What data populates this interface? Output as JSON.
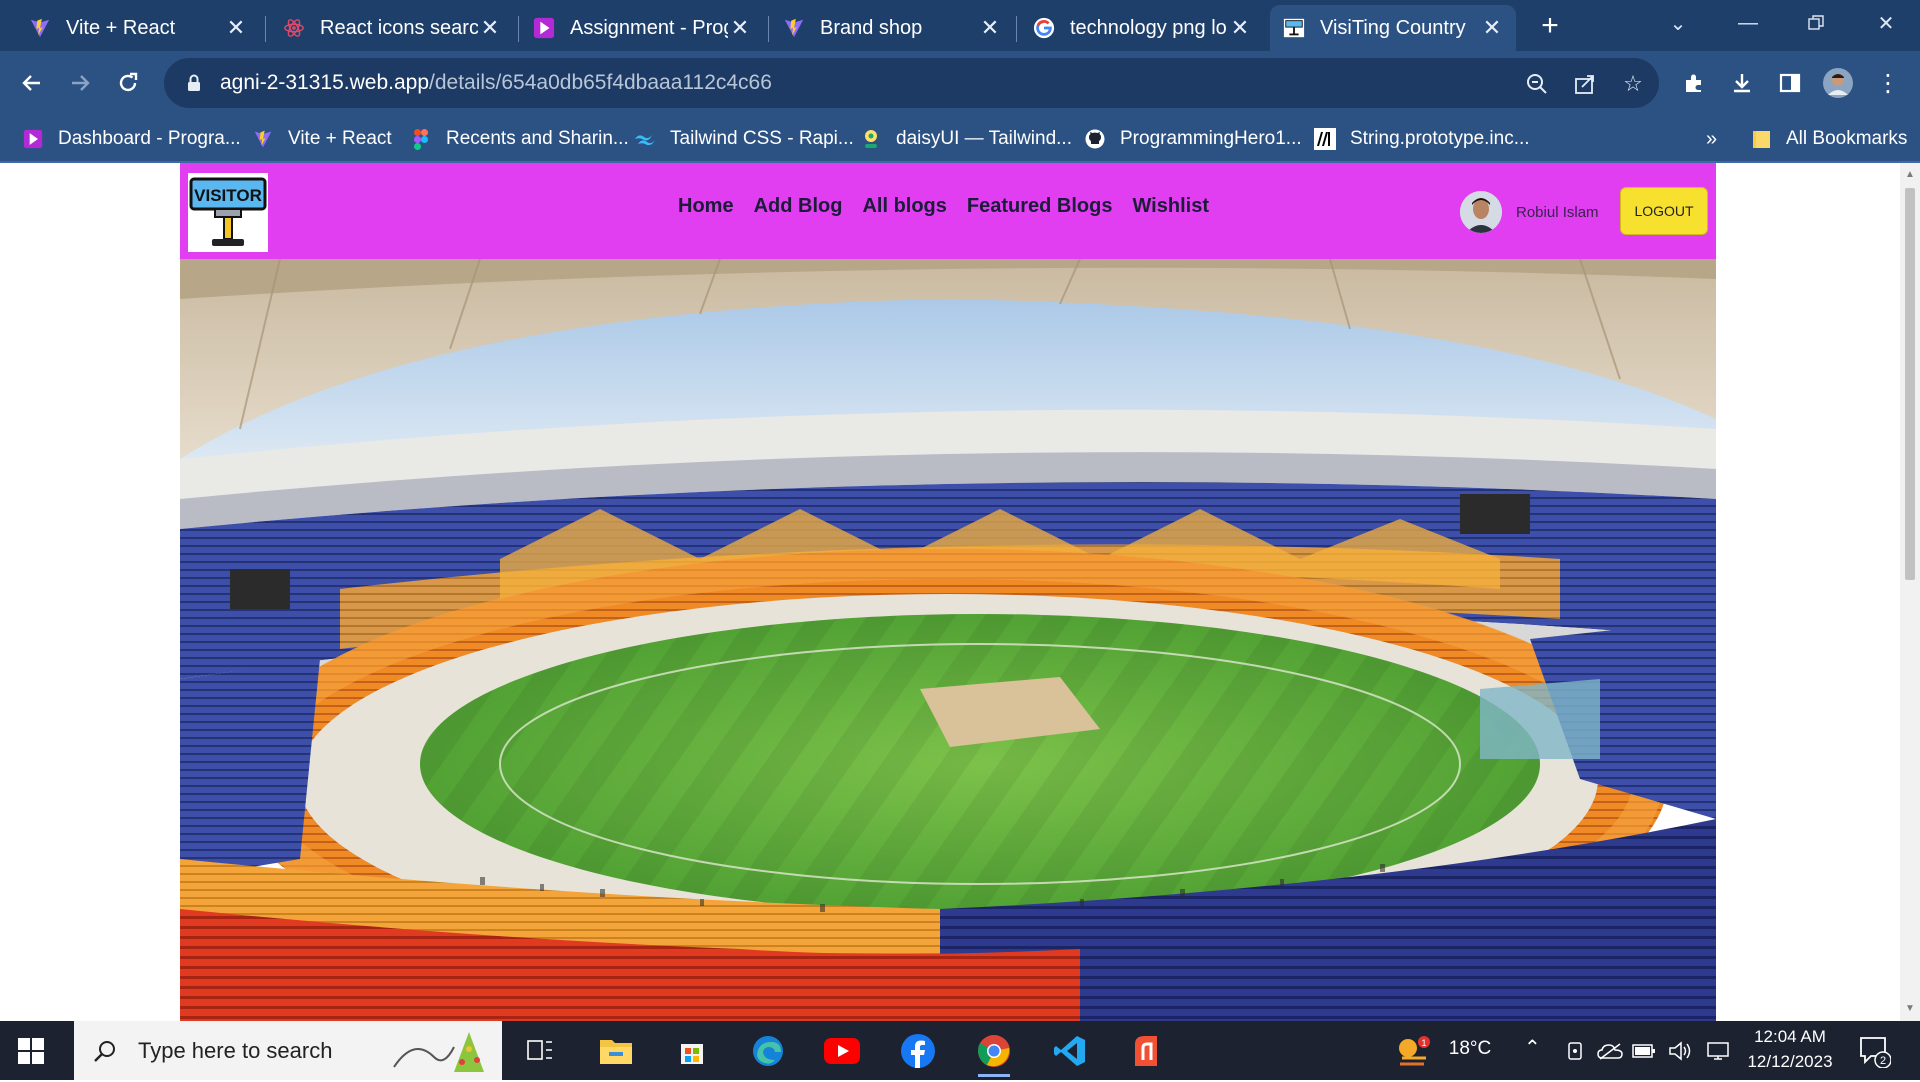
{
  "browser": {
    "tabs": [
      {
        "title": "Vite + React",
        "icon": "vite-icon",
        "active": false
      },
      {
        "title": "React icons search",
        "icon": "react-icon",
        "active": false
      },
      {
        "title": "Assignment - Prog",
        "icon": "programming-hero-icon",
        "active": false
      },
      {
        "title": "Brand shop",
        "icon": "vite-icon",
        "active": false
      },
      {
        "title": "technology png lo",
        "icon": "google-icon",
        "active": false
      },
      {
        "title": "VisiTing Country",
        "icon": "visitor-logo-icon",
        "active": true
      }
    ],
    "new_tab_label": "+",
    "url_host": "agni-2-31315.web.app",
    "url_path": "/details/654a0db65f4dbaaa112c4c66",
    "bookmarks": [
      {
        "label": "Dashboard - Progra...",
        "icon": "programming-hero-icon"
      },
      {
        "label": "Vite + React",
        "icon": "vite-icon"
      },
      {
        "label": "Recents and Sharin...",
        "icon": "figma-icon"
      },
      {
        "label": "Tailwind CSS - Rapi...",
        "icon": "tailwind-icon"
      },
      {
        "label": "daisyUI — Tailwind...",
        "icon": "daisyui-icon"
      },
      {
        "label": "ProgrammingHero1...",
        "icon": "github-icon"
      },
      {
        "label": "String.prototype.inc...",
        "icon": "mdn-icon"
      }
    ],
    "bookmarks_overflow": "»",
    "all_bookmarks_label": "All Bookmarks"
  },
  "site": {
    "logo_text": "VISITOR",
    "nav": [
      "Home",
      "Add Blog",
      "All blogs",
      "Featured Blogs",
      "Wishlist"
    ],
    "user_name": "Robiul Islam",
    "logout_label": "LOGOUT",
    "colors": {
      "navbar": "#e03ef0",
      "logout": "#f8e02e"
    }
  },
  "taskbar": {
    "search_placeholder": "Type here to search",
    "weather_temp": "18°C",
    "weather_badge": "1",
    "time": "12:04 AM",
    "date": "12/12/2023",
    "notification_count": "2"
  }
}
